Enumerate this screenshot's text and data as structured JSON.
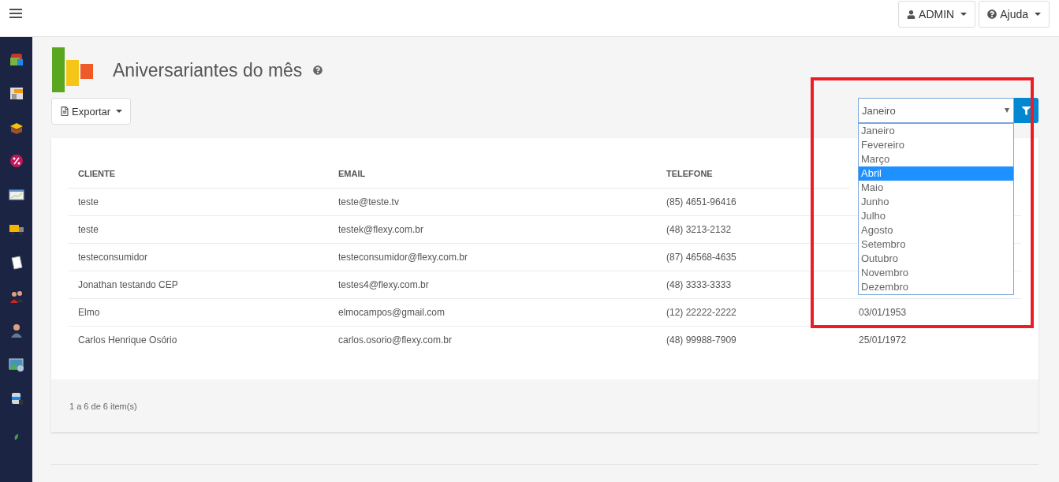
{
  "topbar": {
    "user_button": "ADMIN",
    "help_button": "Ajuda"
  },
  "page": {
    "title": "Aniversariantes do mês",
    "export_button": "Exportar"
  },
  "month_filter": {
    "value": "Janeiro",
    "open": true,
    "options": [
      {
        "label": "Janeiro",
        "highlighted": false
      },
      {
        "label": "Fevereiro",
        "highlighted": false
      },
      {
        "label": "Março",
        "highlighted": false
      },
      {
        "label": "Abril",
        "highlighted": true
      },
      {
        "label": "Maio",
        "highlighted": false
      },
      {
        "label": "Junho",
        "highlighted": false
      },
      {
        "label": "Julho",
        "highlighted": false
      },
      {
        "label": "Agosto",
        "highlighted": false
      },
      {
        "label": "Setembro",
        "highlighted": false
      },
      {
        "label": "Outubro",
        "highlighted": false
      },
      {
        "label": "Novembro",
        "highlighted": false
      },
      {
        "label": "Dezembro",
        "highlighted": false
      }
    ]
  },
  "annotation": {
    "kind": "rectangle"
  },
  "table": {
    "columns": [
      "CLIENTE",
      "EMAIL",
      "TELEFONE"
    ],
    "rows": [
      {
        "cliente": "teste",
        "email": "teste@teste.tv",
        "telefone": "(85) 4651-96416"
      },
      {
        "cliente": "teste",
        "email": "testek@flexy.com.br",
        "telefone": "(48) 3213-2132"
      },
      {
        "cliente": "testeconsumidor",
        "email": "testeconsumidor@flexy.com.br",
        "telefone": "(87) 46568-4635"
      },
      {
        "cliente": "Jonathan testando CEP",
        "email": "testes4@flexy.com.br",
        "telefone": "(48) 3333-3333"
      },
      {
        "cliente": "Elmo",
        "email": "elmocampos@gmail.com",
        "telefone": "(12) 22222-2222",
        "column_4": "03/01/1953"
      },
      {
        "cliente": "Carlos Henrique Osório",
        "email": "carlos.osorio@flexy.com.br",
        "telefone": "(48) 99988-7909",
        "column_4": "25/01/1972"
      }
    ],
    "footer": "1 a 6 de 6 item(s)"
  }
}
